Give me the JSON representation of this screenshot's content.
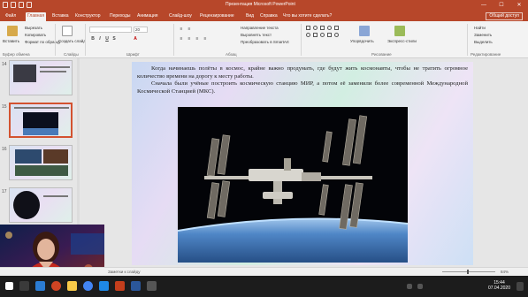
{
  "titlebar": {
    "title": "Презентация Microsoft PowerPoint",
    "minimize": "—",
    "maximize": "☐",
    "close": "✕"
  },
  "ribbon": {
    "tabs": [
      "Файл",
      "Главная",
      "Вставка",
      "Конструктор",
      "Переходы",
      "Анимация",
      "Слайд-шоу",
      "Рецензирование",
      "Вид",
      "Справка"
    ],
    "active_tab": "Главная",
    "tell_me": "Что вы хотите сделать?",
    "share": "Общий доступ",
    "clipboard": {
      "paste": "Вставить",
      "cut": "Вырезать",
      "copy": "Копировать",
      "format_painter": "Формат по образцу",
      "label": "Буфер обмена"
    },
    "slides": {
      "new_slide": "Создать слайд",
      "label": "Слайды"
    },
    "font": {
      "label": "Шрифт",
      "size": "20"
    },
    "paragraph": {
      "text_direction": "Направление текста",
      "align_text": "Выровнять текст",
      "smartart": "Преобразовать в SmartArt",
      "label": "Абзац"
    },
    "drawing": {
      "arrange": "Упорядочить",
      "quick_styles": "Экспресс-стили",
      "label": "Рисование"
    },
    "editing": {
      "find": "Найти",
      "replace": "Заменить",
      "select": "Выделить",
      "label": "Редактирование"
    }
  },
  "thumbnails": [
    {
      "num": "14"
    },
    {
      "num": "15"
    },
    {
      "num": "16"
    },
    {
      "num": "17"
    }
  ],
  "slide": {
    "paragraph1": "Когда начинаешь полёты в космос, крайне важно продумать, где будут жить космонавты, чтобы не тратить огромное количество времени на дорогу к месту работы.",
    "paragraph2": "Сначала были учёные построить космическую станцию МИР, а потом её заменили более современной Международной Космической Станцией (МКС)."
  },
  "statusbar": {
    "notes_hint": "Заметки к слайду",
    "zoom": "84%"
  },
  "taskbar": {
    "time": "15:44",
    "date": "07.04.2020"
  },
  "colors": {
    "accent": "#b7472a",
    "ribbon_bg": "#f3f3f3",
    "taskbar": "#1c1c1c"
  }
}
